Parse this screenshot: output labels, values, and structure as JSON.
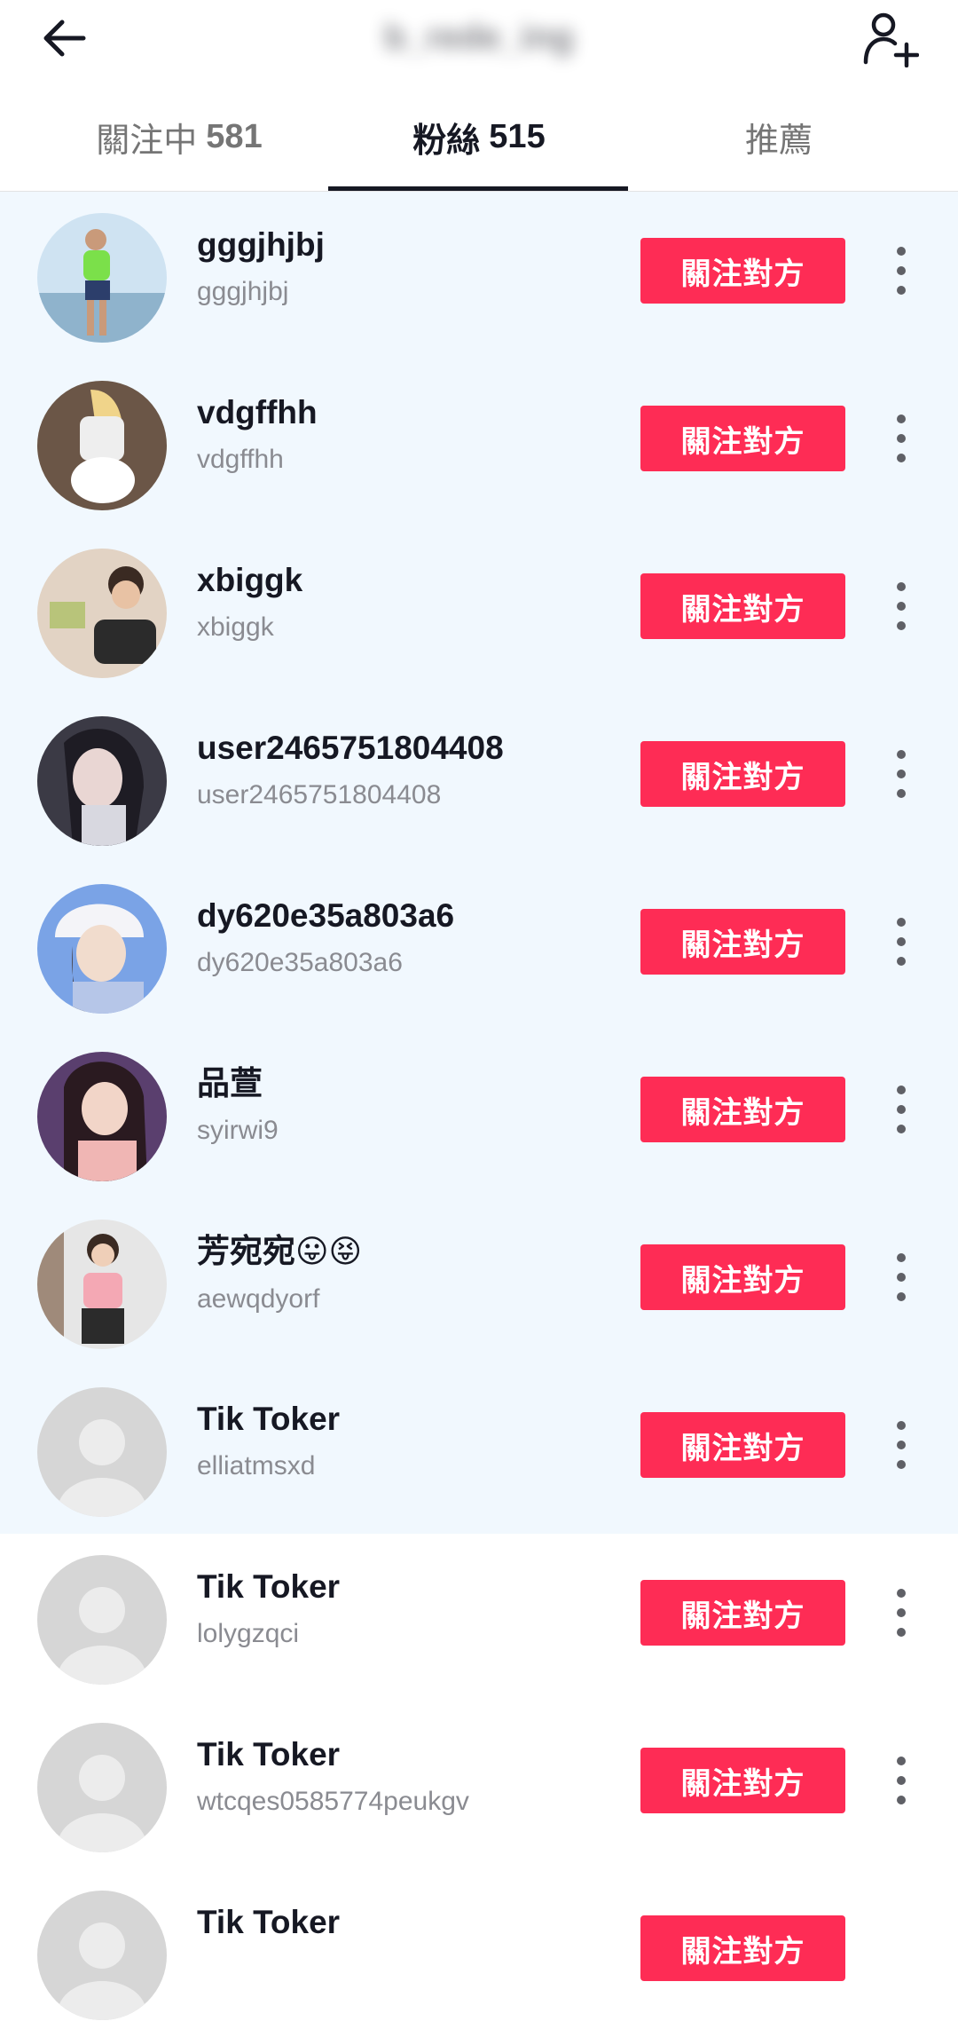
{
  "header": {
    "title": "b_rede_ing",
    "back_icon": "arrow-left-icon",
    "add_icon": "add-user-icon"
  },
  "tabs": [
    {
      "label": "關注中",
      "count": "581"
    },
    {
      "label": "粉絲",
      "count": "515"
    },
    {
      "label": "推薦",
      "count": ""
    }
  ],
  "colors": {
    "accent": "#fe2c55",
    "highlight_bg": "#f1f8fe",
    "text_primary": "#161823",
    "text_secondary": "#8a8b91"
  },
  "follow_label": "關注對方",
  "followers": [
    {
      "name": "gggjhjbj",
      "handle": "gggjhjbj",
      "emoji": ""
    },
    {
      "name": "vdgffhh",
      "handle": "vdgffhh",
      "emoji": ""
    },
    {
      "name": "xbiggk",
      "handle": "xbiggk",
      "emoji": ""
    },
    {
      "name": "user2465751804408",
      "handle": "user2465751804408",
      "emoji": ""
    },
    {
      "name": "dy620e35a803a6",
      "handle": "dy620e35a803a6",
      "emoji": ""
    },
    {
      "name": "品萱",
      "handle": "syirwi9",
      "emoji": ""
    },
    {
      "name": "芳宛宛",
      "handle": "aewqdyorf",
      "emoji": "😛😝"
    },
    {
      "name": "Tik Toker",
      "handle": "elliatmsxd",
      "emoji": ""
    },
    {
      "name": "Tik Toker",
      "handle": "lolygzqci",
      "emoji": ""
    },
    {
      "name": "Tik Toker",
      "handle": "wtcqes0585774peukgv",
      "emoji": ""
    },
    {
      "name": "Tik Toker",
      "handle": "",
      "emoji": ""
    }
  ]
}
